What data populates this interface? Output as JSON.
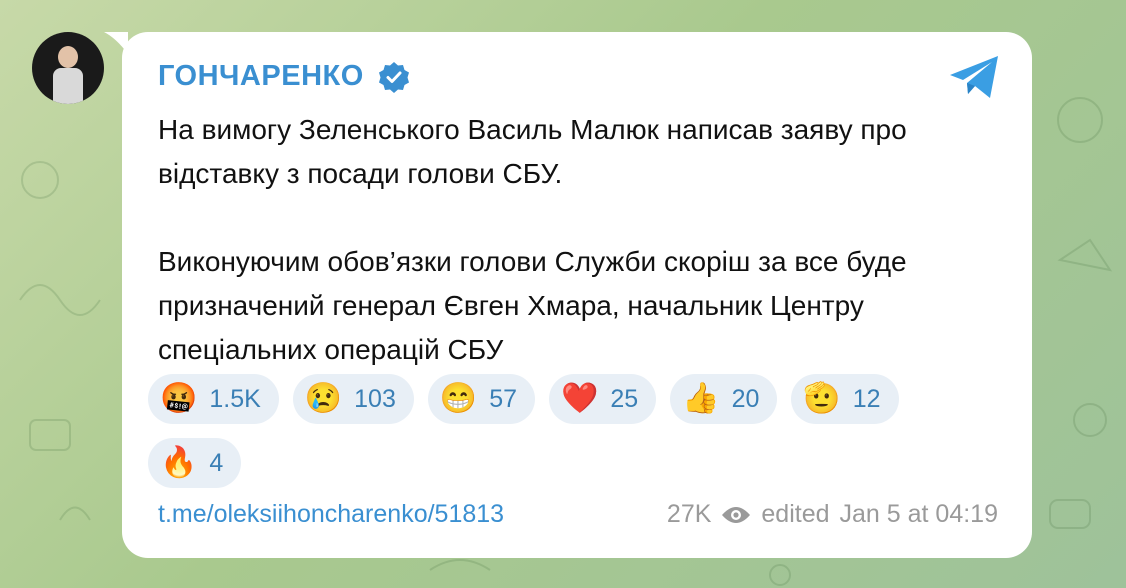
{
  "channel": {
    "name": "ГОНЧАРЕНКО"
  },
  "message": {
    "paragraphs": [
      "На вимогу Зеленського Василь Малюк написав заяву про відставку з посади голови СБУ.",
      "Виконуючим обов’язки голови Служби скоріш за все буде призначений генерал Євген Хмара, начальник Центру спеціальних операцій СБУ"
    ]
  },
  "reactions": [
    {
      "emoji": "🤬",
      "count": "1.5K"
    },
    {
      "emoji": "😢",
      "count": "103"
    },
    {
      "emoji": "😁",
      "count": "57"
    },
    {
      "emoji": "❤️",
      "count": "25"
    },
    {
      "emoji": "👍",
      "count": "20"
    },
    {
      "emoji": "🫡",
      "count": "12"
    },
    {
      "emoji": "🔥",
      "count": "4"
    }
  ],
  "footer": {
    "link": "t.me/oleksiihoncharenko/51813",
    "views": "27K",
    "edited": "edited",
    "date": "Jan 5 at 04:19"
  },
  "colors": {
    "accent": "#3a8fd1",
    "reaction_bg": "#e8eff6",
    "background": "#a9c98e"
  }
}
